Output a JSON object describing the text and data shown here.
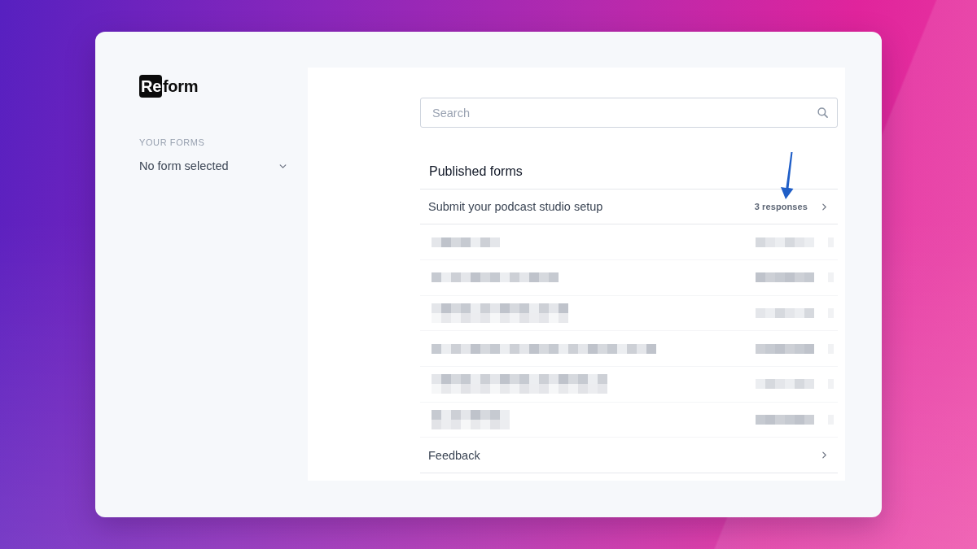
{
  "logo": {
    "badge_text": "Re",
    "text": "form"
  },
  "sidebar": {
    "section_label": "YOUR FORMS",
    "form_picker": {
      "value": "No form selected"
    }
  },
  "search": {
    "placeholder": "Search"
  },
  "published_forms": {
    "title": "Published forms",
    "rows": [
      {
        "kind": "form",
        "title": "Submit your podcast studio setup",
        "responses": "3 responses",
        "annotated": true
      },
      {
        "kind": "redacted"
      },
      {
        "kind": "redacted"
      },
      {
        "kind": "redacted"
      },
      {
        "kind": "redacted"
      },
      {
        "kind": "redacted"
      },
      {
        "kind": "redacted"
      },
      {
        "kind": "form",
        "title": "Feedback",
        "annotated": false
      }
    ]
  }
}
